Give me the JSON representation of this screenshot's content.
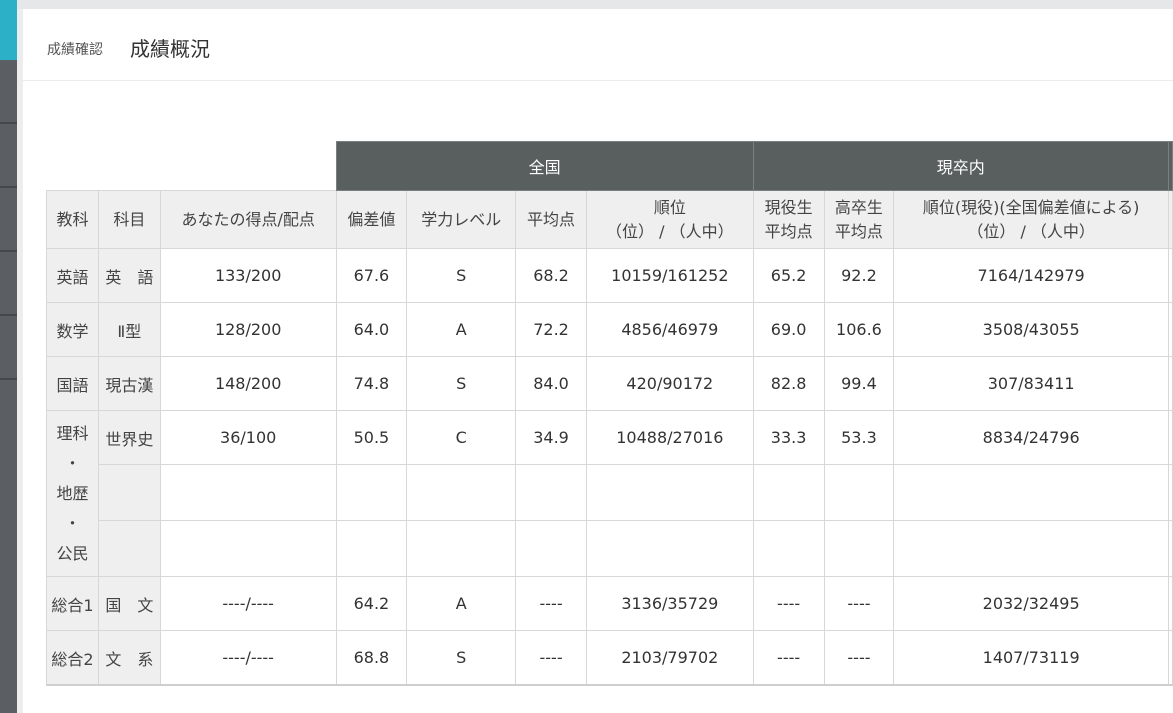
{
  "breadcrumb": "成績確認",
  "page_title": "成績概況",
  "table": {
    "groups": [
      "全国",
      "現卒内"
    ],
    "headers": {
      "kyoka": "教科",
      "kamoku": "科目",
      "score": "あなたの得点/配点",
      "hensachi": "偏差値",
      "level": "学力レベル",
      "avg": "平均点",
      "rank_l1": "順位",
      "rank_l2": "（位） / （人中）",
      "gen_avg_l1": "現役生",
      "gen_avg_l2": "平均点",
      "kou_avg_l1": "高卒生",
      "kou_avg_l2": "平均点",
      "gen_rank_l1": "順位(現役)(全国偏差値による)",
      "gen_rank_l2": "（位） / （人中）"
    },
    "rows": [
      {
        "kyoka": "英語",
        "kamoku": "英　語",
        "score": "133/200",
        "hensachi": "67.6",
        "level": "S",
        "avg": "68.2",
        "rank": "10159/161252",
        "gen_avg": "65.2",
        "kou_avg": "92.2",
        "gen_rank": "7164/142979"
      },
      {
        "kyoka": "数学",
        "kamoku": "Ⅱ型",
        "score": "128/200",
        "hensachi": "64.0",
        "level": "A",
        "avg": "72.2",
        "rank": "4856/46979",
        "gen_avg": "69.0",
        "kou_avg": "106.6",
        "gen_rank": "3508/43055"
      },
      {
        "kyoka": "国語",
        "kamoku": "現古漢",
        "score": "148/200",
        "hensachi": "74.8",
        "level": "S",
        "avg": "84.0",
        "rank": "420/90172",
        "gen_avg": "82.8",
        "kou_avg": "99.4",
        "gen_rank": "307/83411"
      },
      {
        "kyoka_l1": "理科",
        "kyoka_l2": "・",
        "kyoka_l3": "地歴",
        "kyoka_l4": "・",
        "kyoka_l5": "公民",
        "kamoku": "世界史",
        "score": "36/100",
        "hensachi": "50.5",
        "level": "C",
        "avg": "34.9",
        "rank": "10488/27016",
        "gen_avg": "33.3",
        "kou_avg": "53.3",
        "gen_rank": "8834/24796"
      },
      {
        "kyoka": "総合1",
        "kamoku": "国　文",
        "score": "----/----",
        "hensachi": "64.2",
        "level": "A",
        "avg": "----",
        "rank": "3136/35729",
        "gen_avg": "----",
        "kou_avg": "----",
        "gen_rank": "2032/32495"
      },
      {
        "kyoka": "総合2",
        "kamoku": "文　系",
        "score": "----/----",
        "hensachi": "68.8",
        "level": "S",
        "avg": "----",
        "rank": "2103/79702",
        "gen_avg": "----",
        "kou_avg": "----",
        "gen_rank": "1407/73119"
      }
    ]
  }
}
